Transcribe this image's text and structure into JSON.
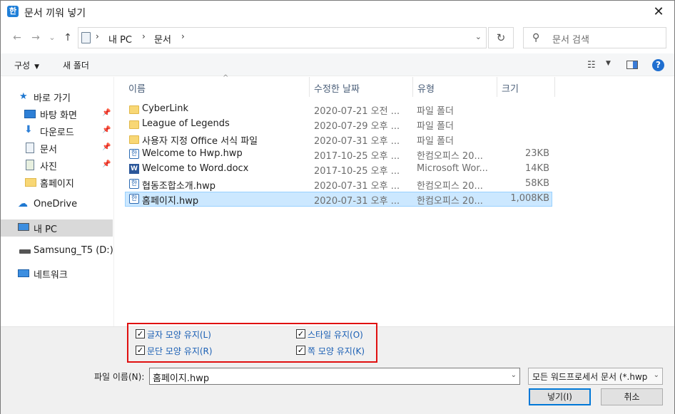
{
  "window": {
    "title": "문서 끼워 넣기",
    "app_icon_glyph": "한",
    "close_glyph": "✕"
  },
  "nav": {
    "back_glyph": "←",
    "forward_glyph": "→",
    "recent_glyph": "⌄",
    "up_glyph": "↑"
  },
  "address": {
    "crumbs": [
      "내 PC",
      "문서"
    ],
    "sep_glyph": "›",
    "dropdown_glyph": "⌄",
    "refresh_glyph": "↻"
  },
  "search": {
    "placeholder": "문서 검색",
    "icon_glyph": "⚲"
  },
  "toolbar": {
    "organize_label": "구성",
    "organize_caret": "▼",
    "new_folder_label": "새 폴더",
    "view_glyph": "☷",
    "view_caret": "▼",
    "help_glyph": "?"
  },
  "sidebar": {
    "pin_glyph": "📌",
    "items": [
      {
        "label": "바로 가기",
        "icon": "star-icon",
        "glyph": "★"
      },
      {
        "label": "바탕 화면",
        "icon": "desktop-icon",
        "pinned": true
      },
      {
        "label": "다운로드",
        "icon": "download-icon",
        "glyph": "⬇",
        "pinned": true
      },
      {
        "label": "문서",
        "icon": "documents-icon",
        "pinned": true
      },
      {
        "label": "사진",
        "icon": "pictures-icon",
        "pinned": true
      },
      {
        "label": "홈페이지",
        "icon": "folder-icon"
      },
      {
        "label": "OneDrive",
        "icon": "cloud-icon",
        "glyph": "☁"
      },
      {
        "label": "내 PC",
        "icon": "computer-icon",
        "selected": true
      },
      {
        "label": "Samsung_T5 (D:)",
        "icon": "drive-icon"
      },
      {
        "label": "네트워크",
        "icon": "network-icon"
      }
    ]
  },
  "columns": {
    "name": "이름",
    "date": "수정한 날짜",
    "type": "유형",
    "size": "크기",
    "sort_glyph": "^"
  },
  "files": [
    {
      "name": "CyberLink",
      "date": "2020-07-21 오전 ...",
      "type": "파일 폴더",
      "size": "",
      "icon": "folder"
    },
    {
      "name": "League of Legends",
      "date": "2020-07-29 오후 ...",
      "type": "파일 폴더",
      "size": "",
      "icon": "folder"
    },
    {
      "name": "사용자 지정 Office 서식 파일",
      "date": "2020-07-31 오후 ...",
      "type": "파일 폴더",
      "size": "",
      "icon": "folder"
    },
    {
      "name": "Welcome to Hwp.hwp",
      "date": "2017-10-25 오후 ...",
      "type": "한컴오피스 20...",
      "size": "23KB",
      "icon": "hwp"
    },
    {
      "name": "Welcome to Word.docx",
      "date": "2017-10-25 오후 ...",
      "type": "Microsoft Wor...",
      "size": "14KB",
      "icon": "word"
    },
    {
      "name": "협동조합소개.hwp",
      "date": "2020-07-31 오후 ...",
      "type": "한컴오피스 20...",
      "size": "58KB",
      "icon": "hwp"
    },
    {
      "name": "홈페이지.hwp",
      "date": "2020-07-31 오후 ...",
      "type": "한컴오피스 20...",
      "size": "1,008KB",
      "icon": "hwp",
      "selected": true
    }
  ],
  "options": {
    "check_glyph": "✓",
    "items": [
      {
        "label": "글자 모양 유지(L)",
        "checked": true
      },
      {
        "label": "스타일 유지(O)",
        "checked": true
      },
      {
        "label": "문단 모양 유지(R)",
        "checked": true
      },
      {
        "label": "쪽 모양 유지(K)",
        "checked": true
      }
    ]
  },
  "footer": {
    "filename_label": "파일 이름(N):",
    "filename_value": "홈페이지.hwp",
    "filter_value": "모든 워드프로세서 문서 (*.hwp",
    "dropdown_glyph": "⌄",
    "open_button": "넣기(I)",
    "cancel_button": "취소"
  },
  "colors": {
    "accent": "#0078d7",
    "selection_bg": "#cce8ff",
    "highlight_box": "#e01010"
  }
}
